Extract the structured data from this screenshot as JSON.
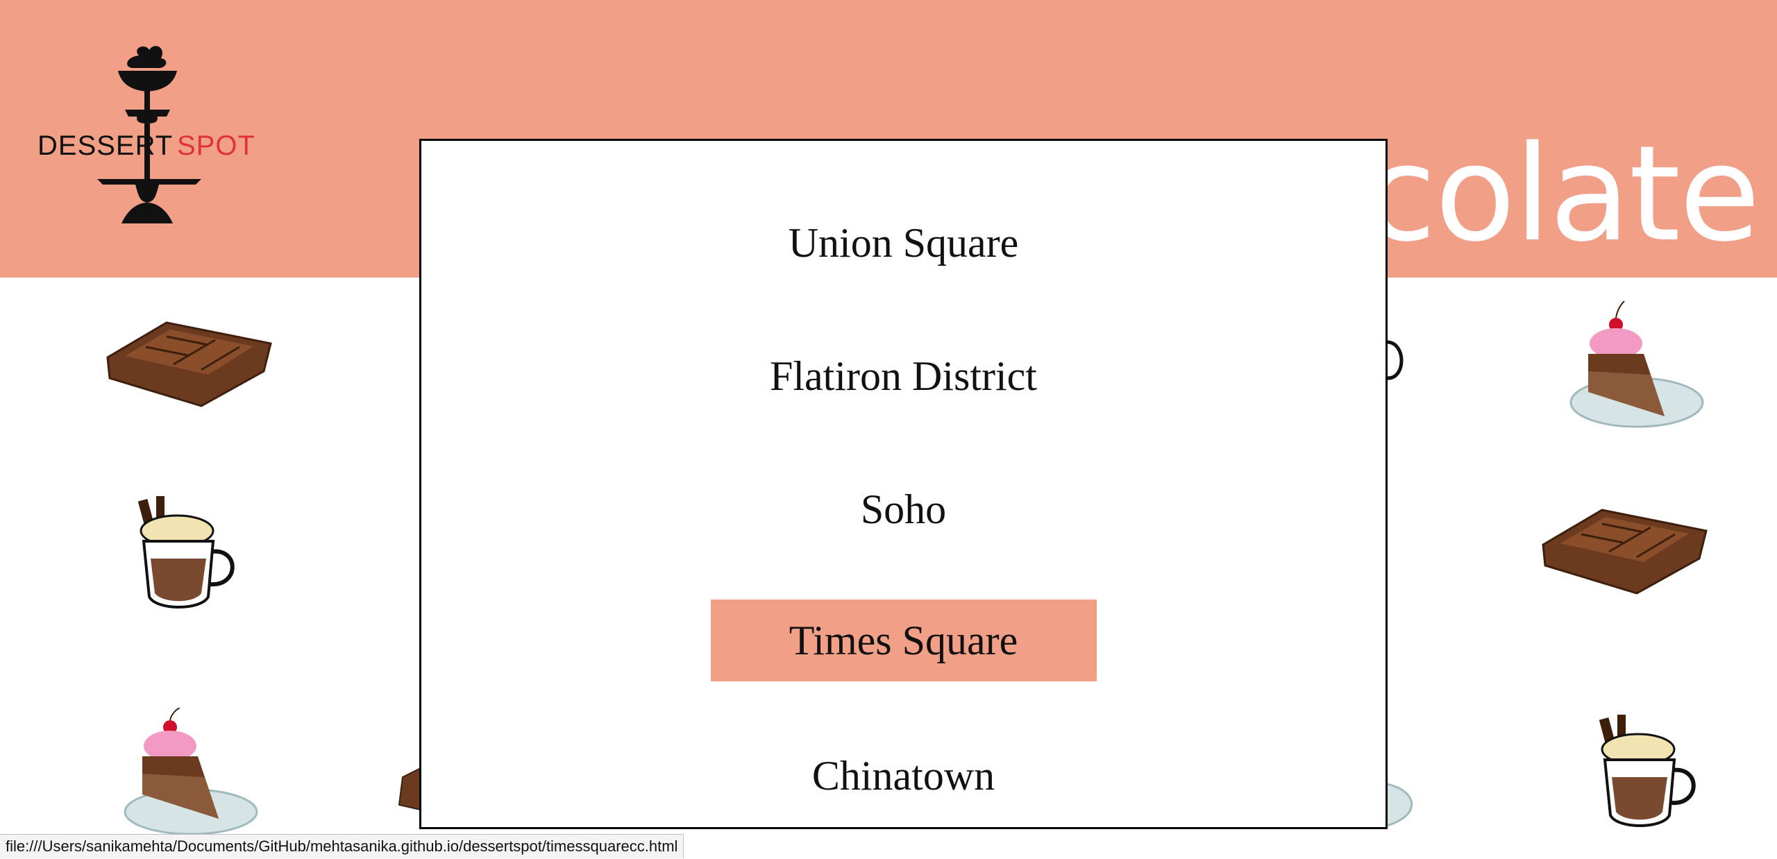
{
  "brand": {
    "logo_word1": "DESSERT",
    "logo_word2": "SPOT",
    "primary_color": "#f1a087",
    "accent_red": "#e0323a"
  },
  "banner": {
    "title": "colate"
  },
  "dropdown": {
    "items": [
      {
        "label": "Union Square"
      },
      {
        "label": "Flatiron District"
      },
      {
        "label": "Soho"
      },
      {
        "label": "Times Square",
        "active": true
      },
      {
        "label": "Chinatown"
      }
    ]
  },
  "decorations": [
    "chocolate-bar-icon",
    "hot-chocolate-mug-icon",
    "cake-slice-icon"
  ],
  "status_bar": {
    "url": "file:///Users/sanikamehta/Documents/GitHub/mehtasanika.github.io/dessertspot/timessquarecc.html"
  }
}
